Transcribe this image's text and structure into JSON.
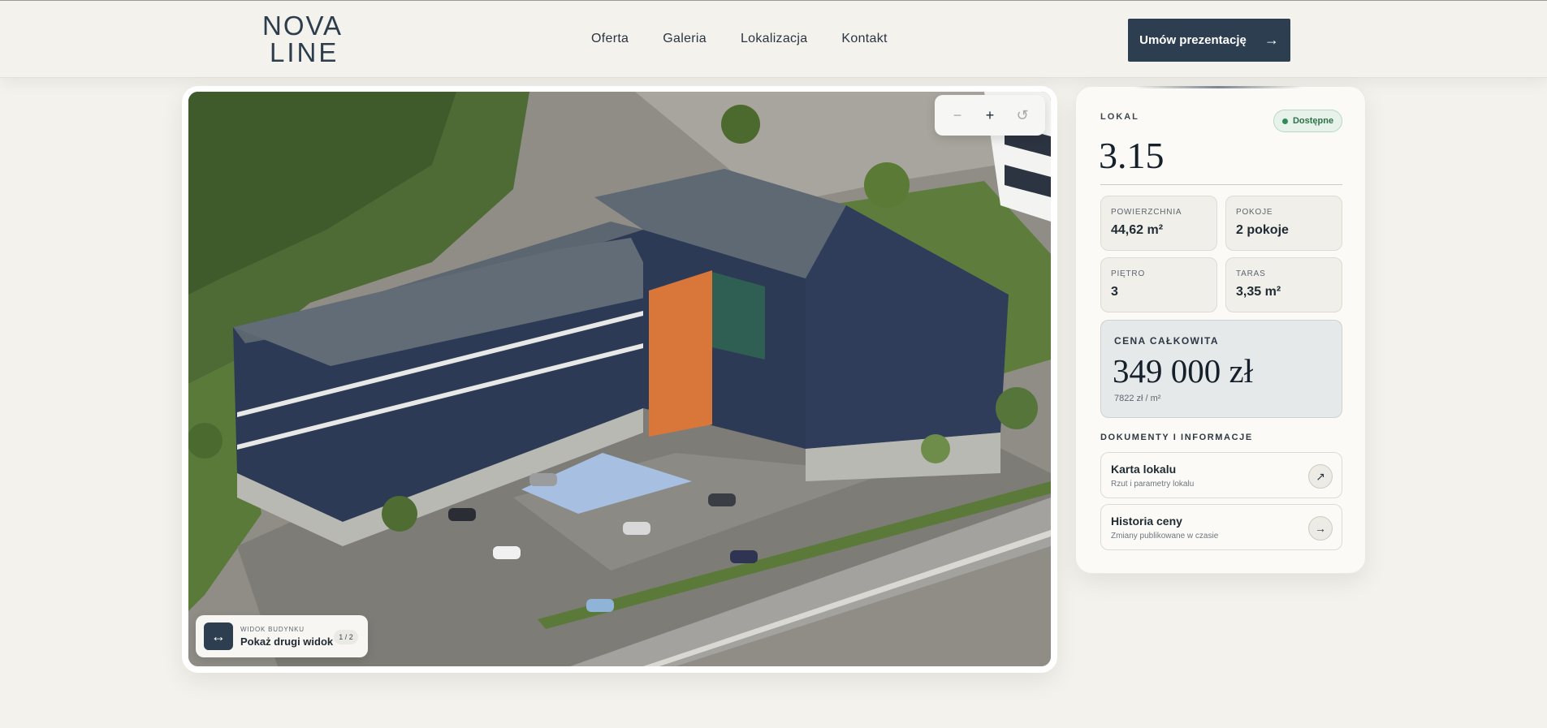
{
  "brand": {
    "line1": "NOVA",
    "line2": "LINE"
  },
  "nav": {
    "items": [
      "Oferta",
      "Galeria",
      "Lokalizacja",
      "Kontakt"
    ]
  },
  "cta": {
    "label": "Umów prezentację",
    "arrow": "→"
  },
  "zoom": {
    "minus": "−",
    "plus": "+",
    "reset": "↺"
  },
  "view_toggle": {
    "icon": "↔",
    "caption": "WIDOK BUDYNKU",
    "label": "Pokaż drugi widok",
    "pager": "1 / 2"
  },
  "panel": {
    "lokal_label": "LOKAL",
    "status": "Dostępne",
    "unit_number": "3.15",
    "stats": [
      {
        "key": "POWIERZCHNIA",
        "value": "44,62 m²"
      },
      {
        "key": "POKOJE",
        "value": "2 pokoje"
      },
      {
        "key": "PIĘTRO",
        "value": "3"
      },
      {
        "key": "TARAS",
        "value": "3,35 m²"
      }
    ],
    "price": {
      "label": "CENA CAŁKOWITA",
      "value": "349 000 zł",
      "per_m2": "7822 zł / m²"
    },
    "docs_label": "DOKUMENTY I INFORMACJE",
    "docs": [
      {
        "title": "Karta lokalu",
        "subtitle": "Rzut i parametry lokalu",
        "icon": "↗"
      },
      {
        "title": "Historia ceny",
        "subtitle": "Zmiany publikowane w czasie",
        "icon": "→"
      }
    ]
  },
  "colors": {
    "accent": "#2c3e4f",
    "highlight_unit": "#e07a3a",
    "status_green": "#2e8b57"
  }
}
